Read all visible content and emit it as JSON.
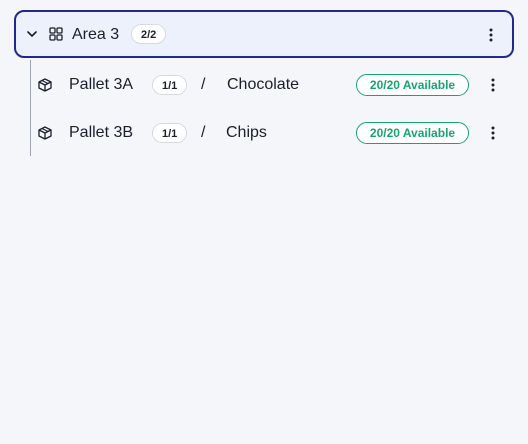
{
  "area": {
    "title": "Area 3",
    "count": "2/2",
    "expanded_icon": "chevron-down-icon",
    "type_icon": "grid-icon",
    "menu_icon": "more-vertical-icon"
  },
  "pallets": [
    {
      "name": "Pallet 3A",
      "count": "1/1",
      "separator": "/",
      "product": "Chocolate",
      "status": "20/20 Available",
      "icon": "package-icon",
      "menu_icon": "more-vertical-icon"
    },
    {
      "name": "Pallet 3B",
      "count": "1/1",
      "separator": "/",
      "product": "Chips",
      "status": "20/20 Available",
      "icon": "package-icon",
      "menu_icon": "more-vertical-icon"
    }
  ],
  "colors": {
    "accent_border": "#1f2a8a",
    "selected_background": "#edf1fb",
    "available_status": "#1aa36f",
    "page_background": "#f5f6fa"
  }
}
